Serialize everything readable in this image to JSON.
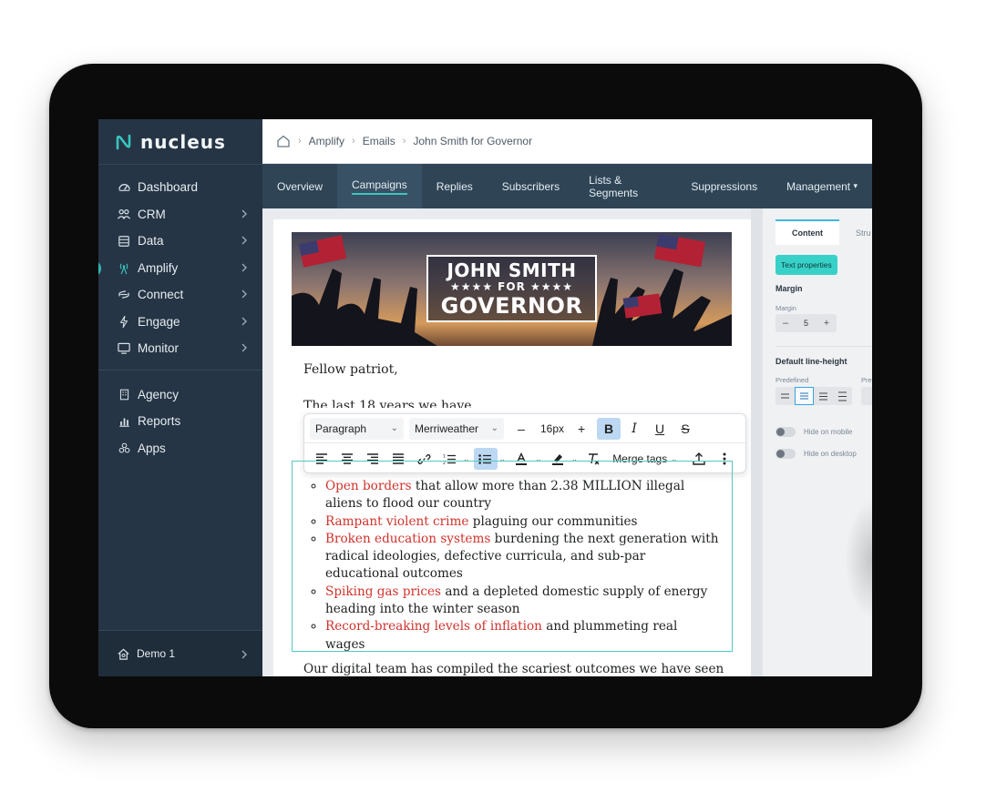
{
  "app": {
    "name": "nucleus"
  },
  "sidebar": {
    "items": [
      {
        "label": "Dashboard",
        "icon": "dashboard-icon"
      },
      {
        "label": "CRM",
        "icon": "people-icon"
      },
      {
        "label": "Data",
        "icon": "database-icon"
      },
      {
        "label": "Amplify",
        "icon": "broadcast-icon"
      },
      {
        "label": "Connect",
        "icon": "link-icon"
      },
      {
        "label": "Engage",
        "icon": "bolt-icon"
      },
      {
        "label": "Monitor",
        "icon": "monitor-icon"
      }
    ],
    "items2": [
      {
        "label": "Agency",
        "icon": "building-icon"
      },
      {
        "label": "Reports",
        "icon": "bar-chart-icon"
      },
      {
        "label": "Apps",
        "icon": "apps-icon"
      }
    ],
    "footer": {
      "label": "Demo 1",
      "icon": "home-icon"
    }
  },
  "breadcrumb": [
    "Amplify",
    "Emails",
    "John Smith for Governor"
  ],
  "tabs": [
    "Overview",
    "Campaigns",
    "Replies",
    "Subscribers",
    "Lists & Segments",
    "Suppressions",
    "Management"
  ],
  "banner": {
    "line1": "JOHN SMITH",
    "line2": "★★★★ FOR ★★★★",
    "line3": "GOVERNOR"
  },
  "email": {
    "greeting": "Fellow patriot,",
    "partial_line": "The last 18 years we have ...",
    "list": [
      {
        "red": "Open borders",
        "rest": " that allow more than 2.38 MILLION illegal aliens to flood our country"
      },
      {
        "red": "Rampant violent crime",
        "rest": " plaguing our communities"
      },
      {
        "red": "Broken education systems",
        "rest": " burdening the next generation with radical ideologies, defective curricula, and sub-par educational outcomes"
      },
      {
        "red": "Spiking gas prices",
        "rest": " and a depleted domestic supply of energy heading into the winter season"
      },
      {
        "red": "Record-breaking levels of inflation",
        "rest": " and plummeting real wages"
      }
    ],
    "paragraph": "Our digital team has compiled the scariest outcomes we have seen"
  },
  "toolbar": {
    "block_type": "Paragraph",
    "font": "Merriweather",
    "font_size": "16px",
    "merge_tags": "Merge tags",
    "minus": "–",
    "plus": "+",
    "bold": "B",
    "italic": "I",
    "underline": "U",
    "strike": "S"
  },
  "panel": {
    "tab_content": "Content",
    "tab_structure": "Stru",
    "chip": "Text properties",
    "margin_heading": "Margin",
    "margin_label": "Margin",
    "margin_value": "5",
    "line_height_heading": "Default line-height",
    "predefined_label": "Predefined",
    "pre_label2": "Pre",
    "hide_mobile": "Hide on mobile",
    "hide_desktop": "Hide on desktop"
  },
  "colors": {
    "sidebar": "#263545",
    "accent": "#38c6c0",
    "red_text": "#d0332c"
  }
}
